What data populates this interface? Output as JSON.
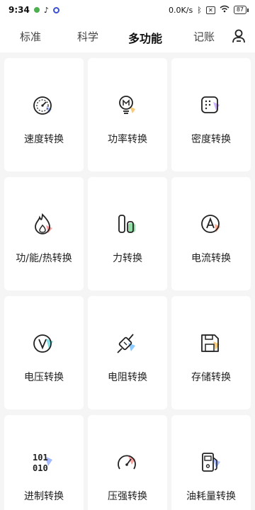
{
  "status_bar": {
    "time": "9:34",
    "network_speed": "0.0K/s",
    "battery": "87"
  },
  "tabs": [
    {
      "label": "标准",
      "active": false
    },
    {
      "label": "科学",
      "active": false
    },
    {
      "label": "多功能",
      "active": true
    },
    {
      "label": "记账",
      "active": false
    }
  ],
  "converters": [
    {
      "label": "速度转换",
      "icon": "speedometer-icon",
      "accent": "#6b8cff"
    },
    {
      "label": "功率转换",
      "icon": "lightbulb-icon",
      "accent": "#f4b43f"
    },
    {
      "label": "密度转换",
      "icon": "density-icon",
      "accent": "#b58cff"
    },
    {
      "label": "功/能/热转换",
      "icon": "flame-icon",
      "accent": "#ff7a7a"
    },
    {
      "label": "力转换",
      "icon": "force-icon",
      "accent": "#4cc46b"
    },
    {
      "label": "电流转换",
      "icon": "ampere-icon",
      "accent": "#ff8a65"
    },
    {
      "label": "电压转换",
      "icon": "voltage-icon",
      "accent": "#4fd1d9"
    },
    {
      "label": "电阻转换",
      "icon": "resistor-icon",
      "accent": "#5cb3ff"
    },
    {
      "label": "存储转换",
      "icon": "floppy-disk-icon",
      "accent": "#f4b43f"
    },
    {
      "label": "进制转换",
      "icon": "binary-icon",
      "accent": "#6b8cff"
    },
    {
      "label": "压强转换",
      "icon": "pressure-gauge-icon",
      "accent": "#ff7a7a"
    },
    {
      "label": "油耗量转换",
      "icon": "fuel-pump-icon",
      "accent": "#6b8cff"
    }
  ]
}
